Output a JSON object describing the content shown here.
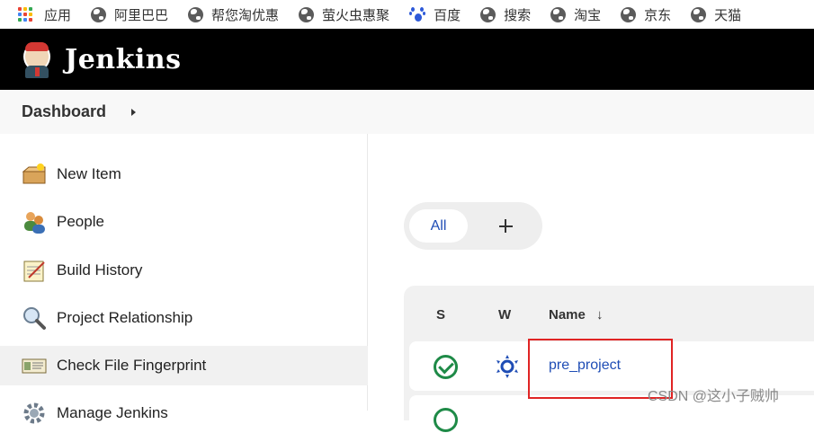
{
  "bookmarks": {
    "items": [
      {
        "label": "应用",
        "icon": "apps-grid-icon"
      },
      {
        "label": "阿里巴巴",
        "icon": "globe-icon"
      },
      {
        "label": "帮您淘优惠",
        "icon": "globe-icon"
      },
      {
        "label": "萤火虫惠聚",
        "icon": "globe-icon"
      },
      {
        "label": "百度",
        "icon": "baidu-paw-icon"
      },
      {
        "label": "搜索",
        "icon": "globe-icon"
      },
      {
        "label": "淘宝",
        "icon": "globe-icon"
      },
      {
        "label": "京东",
        "icon": "globe-icon"
      },
      {
        "label": "天猫",
        "icon": "globe-icon"
      }
    ]
  },
  "header": {
    "brand": "Jenkins",
    "logo_icon": "jenkins-butler-icon"
  },
  "breadcrumb": {
    "item": "Dashboard"
  },
  "sidebar": {
    "items": [
      {
        "label": "New Item",
        "icon": "new-item-icon"
      },
      {
        "label": "People",
        "icon": "people-icon"
      },
      {
        "label": "Build History",
        "icon": "notepad-icon"
      },
      {
        "label": "Project Relationship",
        "icon": "magnifier-icon"
      },
      {
        "label": "Check File Fingerprint",
        "icon": "fingerprint-card-icon"
      },
      {
        "label": "Manage Jenkins",
        "icon": "gear-icon"
      }
    ]
  },
  "views": {
    "tabs": [
      {
        "label": "All",
        "active": true
      }
    ],
    "add_icon": "plus-icon"
  },
  "jobs_table": {
    "headers": {
      "status": "S",
      "weather": "W",
      "name": "Name",
      "sort_indicator": "↓"
    },
    "rows": [
      {
        "name": "pre_project",
        "status_icon": "success-check-icon",
        "weather_icon": "sunny-icon"
      }
    ]
  },
  "colors": {
    "link": "#1f4db5",
    "success": "#1e8a47",
    "highlight": "#e02424",
    "header_bg": "#000000"
  },
  "watermark": "CSDN @这小子贼帅"
}
